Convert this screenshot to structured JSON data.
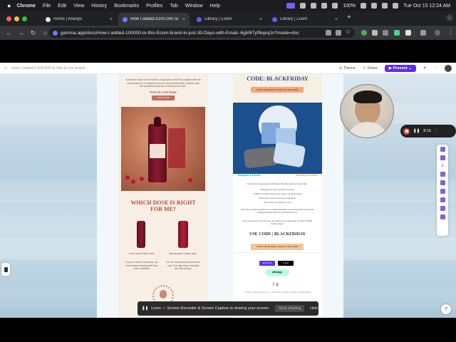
{
  "menubar": {
    "apple": "",
    "items": [
      "Chrome",
      "File",
      "Edit",
      "View",
      "History",
      "Bookmarks",
      "Profiles",
      "Tab",
      "Window",
      "Help"
    ],
    "battery": "100%",
    "datetime": "Tue Oct 15  12:24 AM"
  },
  "tabs": [
    {
      "label": "Home | Klaviyo",
      "active": false,
      "color": "#1f1f1f"
    },
    {
      "label": "How I added £100,000 to this",
      "active": true,
      "color": "#6b7cff"
    },
    {
      "label": "Library | Loom",
      "active": false,
      "color": "#625df5"
    },
    {
      "label": "Library | Loom",
      "active": false,
      "color": "#625df5"
    }
  ],
  "address": {
    "url": "gamma.app/docs/How-I-added-100000-to-this-Ecom-brand-in-just-30-Days-with-Email--6gbf47yf9opnj1n?mode=doc"
  },
  "gamma": {
    "breadcrumb": "How I added £100,000 to this Ecom brand...",
    "theme_label": "Theme",
    "share_label": "Share",
    "present_label": "Present"
  },
  "email_left": {
    "intro": "A newborn take on the former Long Island Iced Tea Cocktail with the overall flavour of raspberry, lemon and smoked chilli, Infusion with the wonderful aromas of Damascus Rose.",
    "section_label": "NOW IN LOW DOSE",
    "button": "SHOP NOW",
    "heading": "WHICH DOSE IS RIGHT FOR ME?",
    "col1_title": "LOW DOSE 5MG THC",
    "col1_body": "If you're new to cannabis, we recommend starting with low dose cocktails.",
    "col2_title": "HIGH DOSE 10MG THC",
    "col2_body": "For the experienced consumer only. Our high dose cocktails are very strong."
  },
  "email_right": {
    "code_heading": "CODE: BLACKFRIDAY",
    "cta": "SHOP THE BIGGEST SALE OF THE YEAR",
    "trust_left": "Trustpilot",
    "trust_right": "Reviews",
    "lines": [
      "Get Calming Sleepwear with Sleep Ultimates gift for those cold...",
      "Designed for deep and fast recovery",
      "Crafted to reduce stress and make you sleep better",
      "Experience restful and deep relaxation",
      "Direct from our factory to you"
    ],
    "para": "We have a limited selection of weighted blankets and accessories as well as weighted blanket sleeves and blanket sets.",
    "para2": "It's a limited time only and you can grab all our sleepwear at HALF PRICE. Ends tonight.",
    "code_line": "USE CODE | BLACKFRIDAY",
    "cta2": "SHOP THE BIGGEST SALE OF THE YEAR",
    "pay1": "Shop Pay",
    "pay2": "G Pay",
    "pay3": "afterpay",
    "footer": "Calmer Collective Pty Ltd, 1 Test Street, Sydney NSW, Australia 2000"
  },
  "loom": {
    "timer": "8:15",
    "share_text": "Loom — Screen Recorder & Screen Capture is sharing your screen.",
    "stop_label": "Stop sharing",
    "hide_label": "Hide"
  },
  "help_label": "?"
}
